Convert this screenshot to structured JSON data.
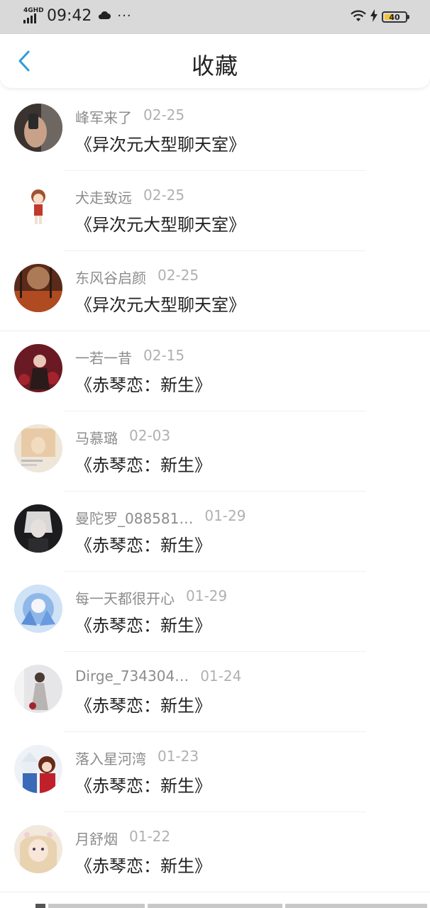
{
  "status_bar": {
    "network": "4GHD",
    "time": "09:42",
    "dots": "···",
    "battery": "40"
  },
  "nav": {
    "title": "收藏"
  },
  "items": [
    {
      "name": "峰军来了",
      "date": "02-25",
      "content": "《异次元大型聊天室》"
    },
    {
      "name": "犬走致远",
      "date": "02-25",
      "content": "《异次元大型聊天室》"
    },
    {
      "name": "东风谷启颜",
      "date": "02-25",
      "content": "《异次元大型聊天室》"
    },
    {
      "name": "一若一昔",
      "date": "02-15",
      "content": "《赤琴恋：新生》"
    },
    {
      "name": "马慕璐",
      "date": "02-03",
      "content": "《赤琴恋：新生》"
    },
    {
      "name": "曼陀罗_088581…",
      "date": "01-29",
      "content": "《赤琴恋：新生》"
    },
    {
      "name": "每一天都很开心",
      "date": "01-29",
      "content": "《赤琴恋：新生》"
    },
    {
      "name": "Dirge_734304…",
      "date": "01-24",
      "content": "《赤琴恋：新生》"
    },
    {
      "name": "落入星河湾",
      "date": "01-23",
      "content": "《赤琴恋：新生》"
    },
    {
      "name": "月舒烟",
      "date": "01-22",
      "content": "《赤琴恋：新生》"
    }
  ],
  "colors": {
    "accent": "#2d9cdb",
    "battery": "#f4c534"
  }
}
